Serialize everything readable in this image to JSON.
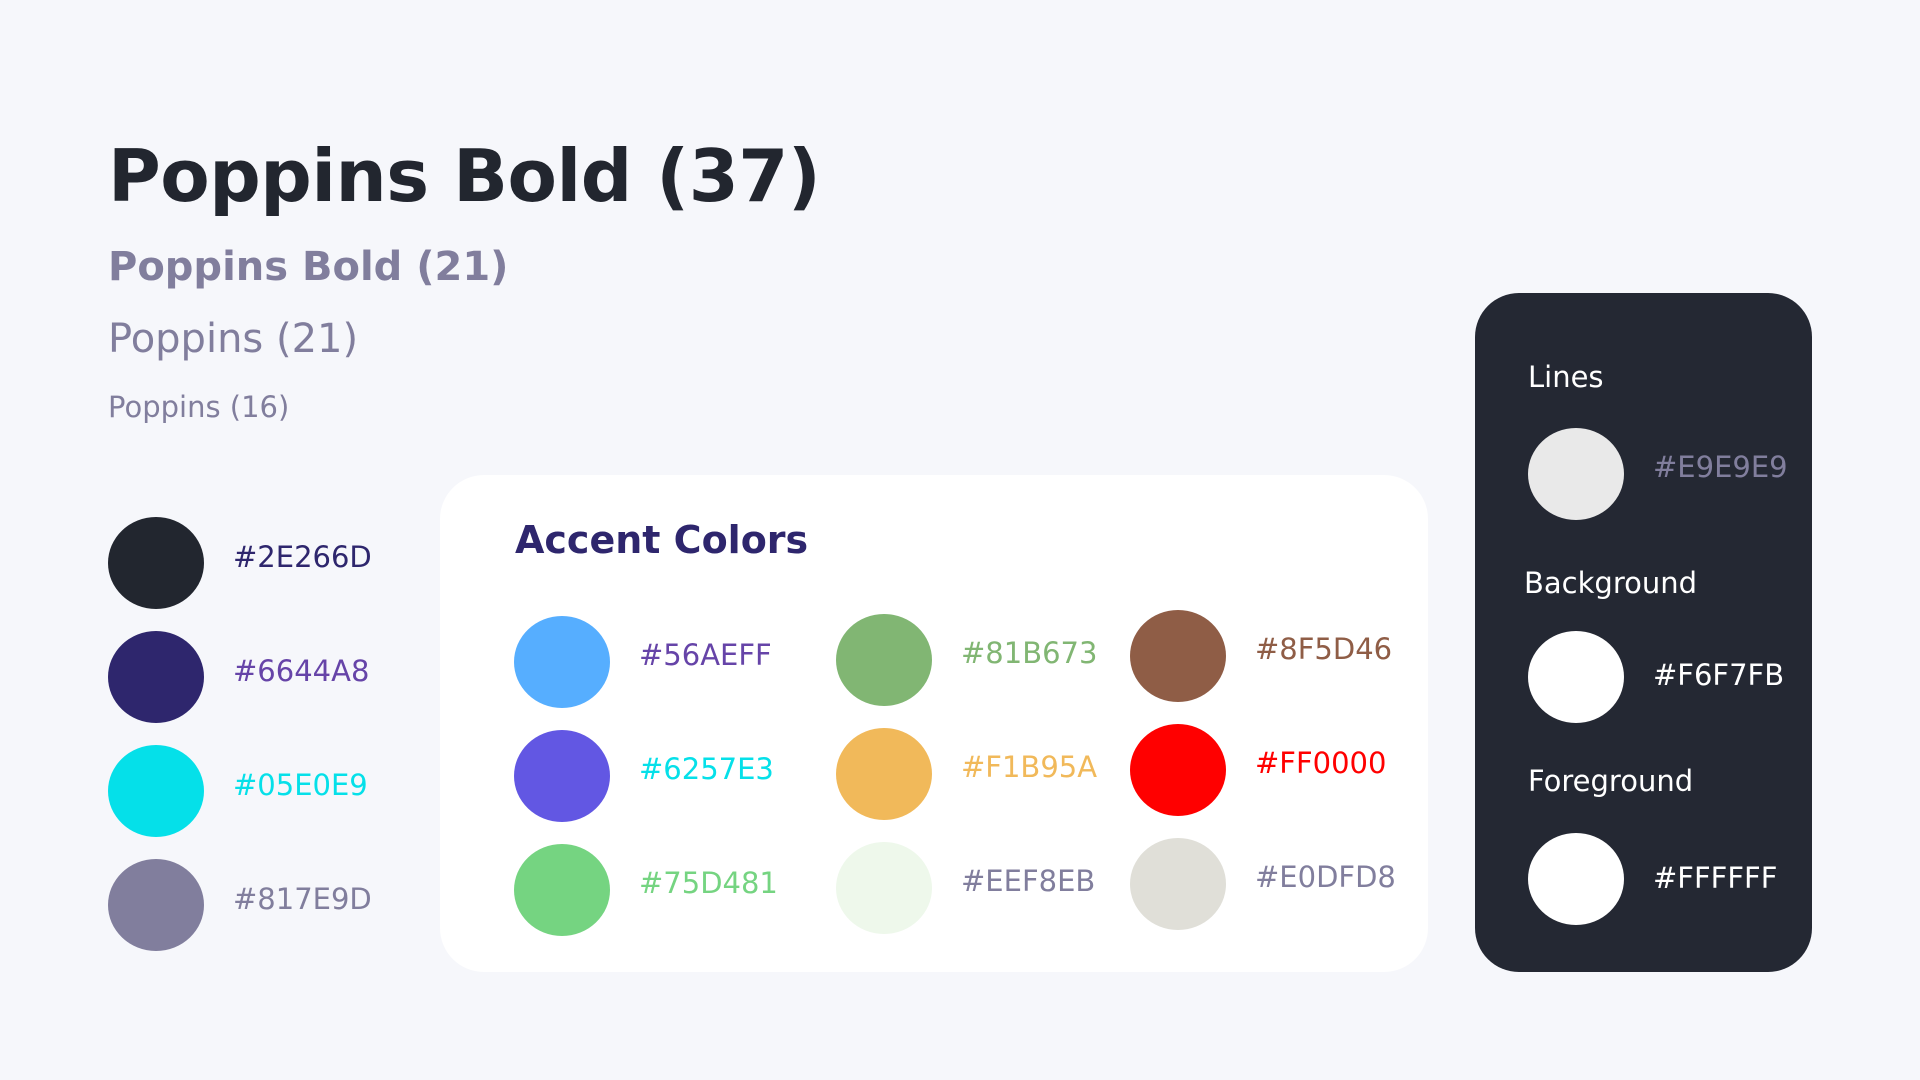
{
  "typography": {
    "heading_xl": "Poppins Bold (37)",
    "heading_md": "Poppins Bold (21)",
    "body_md": "Poppins (21)",
    "body_sm": "Poppins (16)"
  },
  "primary_colors": [
    {
      "hex": "#2E266D",
      "swatch": "#22262F",
      "text_color": "#2E266D"
    },
    {
      "hex": "#6644A8",
      "swatch": "#2E266D",
      "text_color": "#6644A8"
    },
    {
      "hex": "#05E0E9",
      "swatch": "#05E0E9",
      "text_color": "#05E0E9"
    },
    {
      "hex": "#817E9D",
      "swatch": "#817E9D",
      "text_color": "#817E9D"
    }
  ],
  "accent": {
    "title": "Accent Colors",
    "colors": [
      {
        "hex": "#56AEFF",
        "swatch": "#56AEFF",
        "text_color": "#6644A8"
      },
      {
        "hex": "#6257E3",
        "swatch": "#6257E3",
        "text_color": "#05E0E9"
      },
      {
        "hex": "#75D481",
        "swatch": "#75D481",
        "text_color": "#75D481"
      },
      {
        "hex": "#81B673",
        "swatch": "#81B673",
        "text_color": "#81B673"
      },
      {
        "hex": "#F1B95A",
        "swatch": "#F1B95A",
        "text_color": "#F1B95A"
      },
      {
        "hex": "#EEF8EB",
        "swatch": "#EEF8EB",
        "text_color": "#817E9D"
      },
      {
        "hex": "#8F5D46",
        "swatch": "#8F5D46",
        "text_color": "#8F5D46"
      },
      {
        "hex": "#FF0000",
        "swatch": "#FF0000",
        "text_color": "#FF0000"
      },
      {
        "hex": "#E0DFD8",
        "swatch": "#E0DFD8",
        "text_color": "#817E9D"
      }
    ]
  },
  "neutral": {
    "lines": {
      "label": "Lines",
      "hex": "#E9E9E9",
      "swatch": "#E9E9E9",
      "text_color": "#817E9D"
    },
    "background": {
      "label": "Background",
      "hex": "#F6F7FB",
      "swatch": "#FFFFFF",
      "text_color": "#FFFFFF"
    },
    "foreground": {
      "label": "Foreground",
      "hex": "#FFFFFF",
      "swatch": "#FFFFFF",
      "text_color": "#FFFFFF"
    }
  }
}
